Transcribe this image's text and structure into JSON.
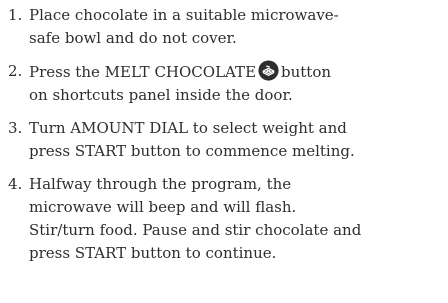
{
  "steps": [
    {
      "number": "1.",
      "lines": [
        "Place chocolate in a suitable microwave-",
        "safe bowl and do not cover."
      ]
    },
    {
      "number": "2.",
      "line1_before": "Press the MELT CHOCOLATE",
      "line1_after": "button",
      "line2": "on shortcuts panel inside the door.",
      "icon": "melt-chocolate-icon"
    },
    {
      "number": "3.",
      "lines": [
        "Turn AMOUNT DIAL to select weight and",
        "press START button to commence melting."
      ]
    },
    {
      "number": "4.",
      "lines": [
        "Halfway through the program, the",
        "microwave will beep and will flash.",
        "Stir/turn food. Pause and stir chocolate and",
        "press START button to continue."
      ]
    }
  ],
  "colors": {
    "text": "#2e2e2e",
    "icon_bg": "#2e2e2e",
    "icon_fg": "#ffffff"
  }
}
